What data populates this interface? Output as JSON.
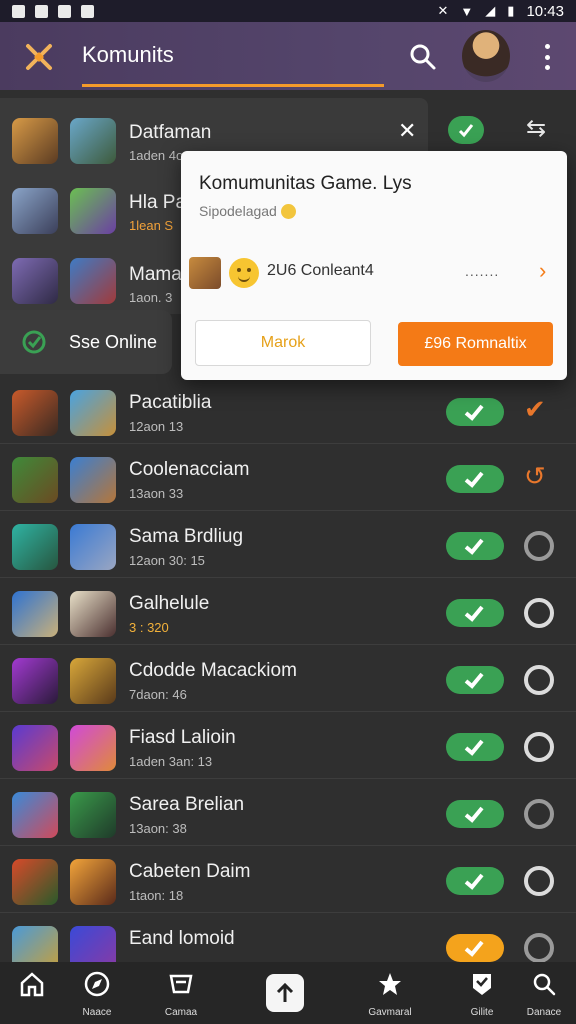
{
  "status_bar": {
    "time": "10:43"
  },
  "header": {
    "title": "Komunits"
  },
  "list_top": {
    "name": "Datfaman",
    "sub": "1aden 4on. 1"
  },
  "rows_partial": [
    {
      "name": "Hla Pa",
      "sub": "1lean S"
    },
    {
      "name": "Mama",
      "sub": "1aon. 3"
    }
  ],
  "online": {
    "label": "Sse Online"
  },
  "dialog": {
    "title": "Komumunitas Game. Lys",
    "subtitle": "Sipodelagad",
    "item_label": "2U6 Conleant4",
    "item_dots": ".......",
    "cancel_label": "Marok",
    "primary_label": "£96 Romnaltix"
  },
  "rows": [
    {
      "name": "Pacatiblia",
      "sub": "12aon 13",
      "toggle": "green",
      "end": "orange-check"
    },
    {
      "name": "Coolenacciam",
      "sub": "13aon 33",
      "toggle": "green",
      "end": "orange-c"
    },
    {
      "name": "Sama Brdliug",
      "sub": "12aon 30: 15",
      "toggle": "green",
      "end": "ring-dim"
    },
    {
      "name": "Galhelule",
      "sub": "3 : 320",
      "toggle": "green",
      "end": "ring"
    },
    {
      "name": "Cdodde Macackiom",
      "sub": "7daon: 46",
      "toggle": "green",
      "end": "ring"
    },
    {
      "name": "Fiasd Lalioin",
      "sub": "1aden 3an: 13",
      "toggle": "green",
      "end": "ring"
    },
    {
      "name": "Sarea Brelian",
      "sub": "13aon: 38",
      "toggle": "green",
      "end": "ring-dim"
    },
    {
      "name": "Cabeten Daim",
      "sub": "1taon: 18",
      "toggle": "green",
      "end": "ring"
    },
    {
      "name": "Eand lomoid",
      "sub": "",
      "toggle": "orange",
      "end": "ring-dim"
    }
  ],
  "bottom_nav": [
    {
      "icon": "home-icon",
      "label": ""
    },
    {
      "icon": "compass-icon",
      "label": "Naace"
    },
    {
      "icon": "box-icon",
      "label": "Camaa"
    },
    {
      "icon": "upload-icon",
      "label": ""
    },
    {
      "icon": "star-icon",
      "label": "Gavmaral"
    },
    {
      "icon": "badge-icon",
      "label": "Gilite"
    },
    {
      "icon": "search-icon",
      "label": "Danace"
    }
  ],
  "colors": {
    "accent": "#f47a16",
    "toggle_on": "#3aa154",
    "header_bg": "#4b3b5f",
    "list_bg": "#2f2f2f"
  }
}
